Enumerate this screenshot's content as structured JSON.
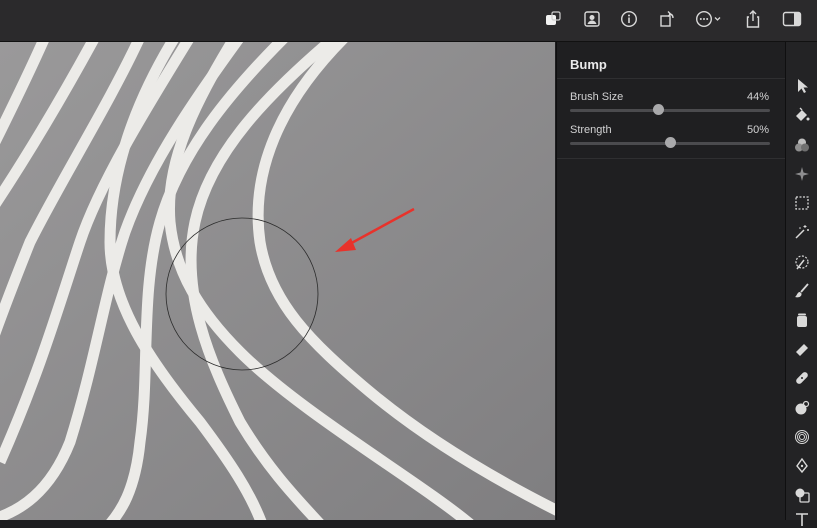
{
  "panel": {
    "title": "Bump",
    "brush_size": {
      "label": "Brush Size",
      "value_text": "44%",
      "value": 0.44
    },
    "strength": {
      "label": "Strength",
      "value_text": "50%",
      "value": 0.5
    }
  },
  "toolbar": {
    "icons": [
      "layers-icon",
      "portrait-icon",
      "info-icon",
      "rotate-icon",
      "more-icon",
      "share-icon",
      "sidebar-icon"
    ]
  },
  "tools": {
    "icons": [
      "pointer-icon",
      "paint-bucket-icon",
      "color-blend-icon",
      "sparkle-icon",
      "rect-select-icon",
      "magic-wand-icon",
      "quick-select-icon",
      "brush-icon",
      "paint-jar-icon",
      "eraser-icon",
      "bandage-icon",
      "clone-icon",
      "distort-icon",
      "pen-icon",
      "shape-icon",
      "text-icon"
    ]
  },
  "colors": {
    "accent_arrow": "#e8322b",
    "panel_bg": "#1f1f21",
    "toolbar_bg": "#2b2a2c"
  }
}
